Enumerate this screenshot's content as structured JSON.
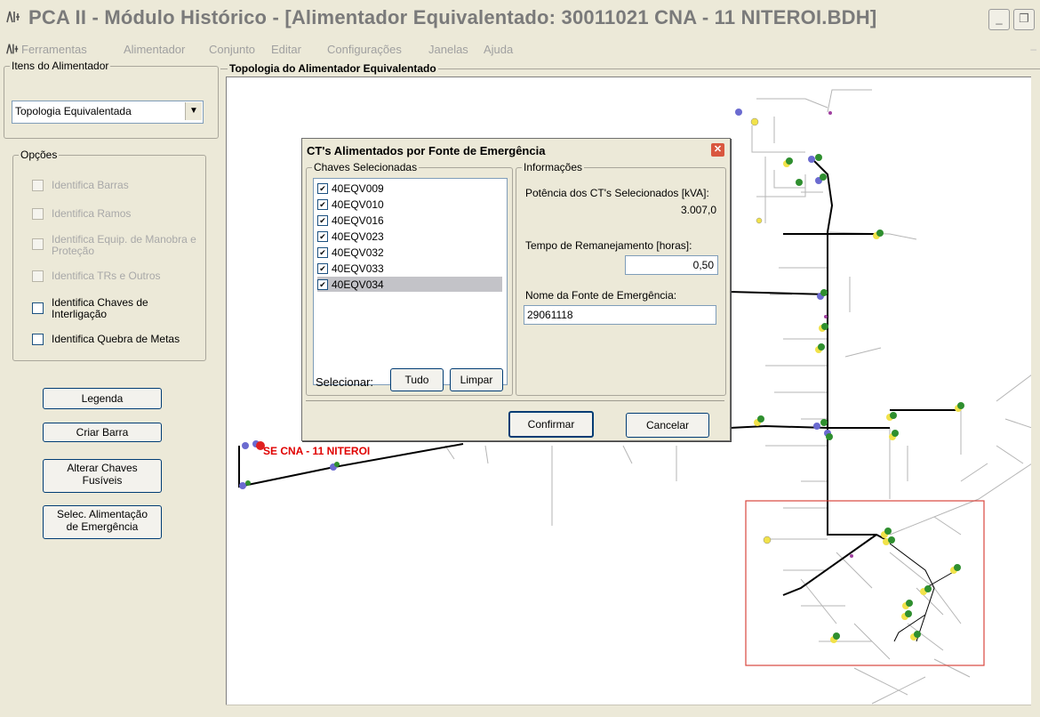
{
  "window": {
    "icon": "app-logo-icon",
    "title": "PCA II - Módulo Histórico - [Alimentador Equivalentado: 30011021 CNA - 11 NITEROI.BDH]",
    "minimize": "_",
    "restore": "❐"
  },
  "menu": {
    "items": [
      "Ferramentas",
      "Alimentador",
      "Conjunto",
      "Editar",
      "Configurações",
      "Janelas",
      "Ajuda"
    ]
  },
  "left_panel": {
    "itens_title": "Itens do Alimentador",
    "dropdown_value": "Topologia Equivalentada",
    "opcoes_title": "Opções",
    "options": [
      {
        "label": "Identifica Barras",
        "enabled": false
      },
      {
        "label": "Identifica Ramos",
        "enabled": false
      },
      {
        "label": "Identifica Equip. de Manobra e Proteção",
        "enabled": false
      },
      {
        "label": "Identifica TRs e Outros",
        "enabled": false
      },
      {
        "label": "Identifica Chaves de Interligação",
        "enabled": true
      },
      {
        "label": "Identifica Quebra de Metas",
        "enabled": true
      }
    ],
    "buttons": {
      "legenda": "Legenda",
      "criar_barra": "Criar Barra",
      "alterar_1": "Alterar Chaves",
      "alterar_2": "Fusíveis",
      "selec_1": "Selec. Alimentação",
      "selec_2": "de Emergência"
    }
  },
  "map": {
    "title": "Topologia do Alimentador Equivalentado",
    "substation_label": "SE CNA - 11 NITEROI"
  },
  "dialog": {
    "title": "CT's Alimentados por Fonte de Emergência",
    "chaves_title": "Chaves Selecionadas",
    "chaves": [
      {
        "id": "40EQV009",
        "checked": true
      },
      {
        "id": "40EQV010",
        "checked": true
      },
      {
        "id": "40EQV016",
        "checked": true
      },
      {
        "id": "40EQV023",
        "checked": true
      },
      {
        "id": "40EQV032",
        "checked": true
      },
      {
        "id": "40EQV033",
        "checked": true
      },
      {
        "id": "40EQV034",
        "checked": true
      }
    ],
    "selecionar_label": "Selecionar:",
    "tudo_button": "Tudo",
    "limpar_button": "Limpar",
    "info_title": "Informações",
    "potencia_label": "Potência dos CT's Selecionados [kVA]:",
    "potencia_value": "3.007,0",
    "tempo_label": "Tempo de Remanejamento [horas]:",
    "tempo_value": "0,50",
    "fonte_label": "Nome da Fonte de Emergência:",
    "fonte_value": "29061118",
    "confirmar_button": "Confirmar",
    "cancelar_button": "Cancelar"
  },
  "colors": {
    "background": "#ece9d8",
    "highlight_box": "#d9463e",
    "substation_label": "#e00000",
    "node_green": "#2f8f2f",
    "node_yellow": "#f1e24a",
    "node_blue": "#6b6bd0"
  }
}
